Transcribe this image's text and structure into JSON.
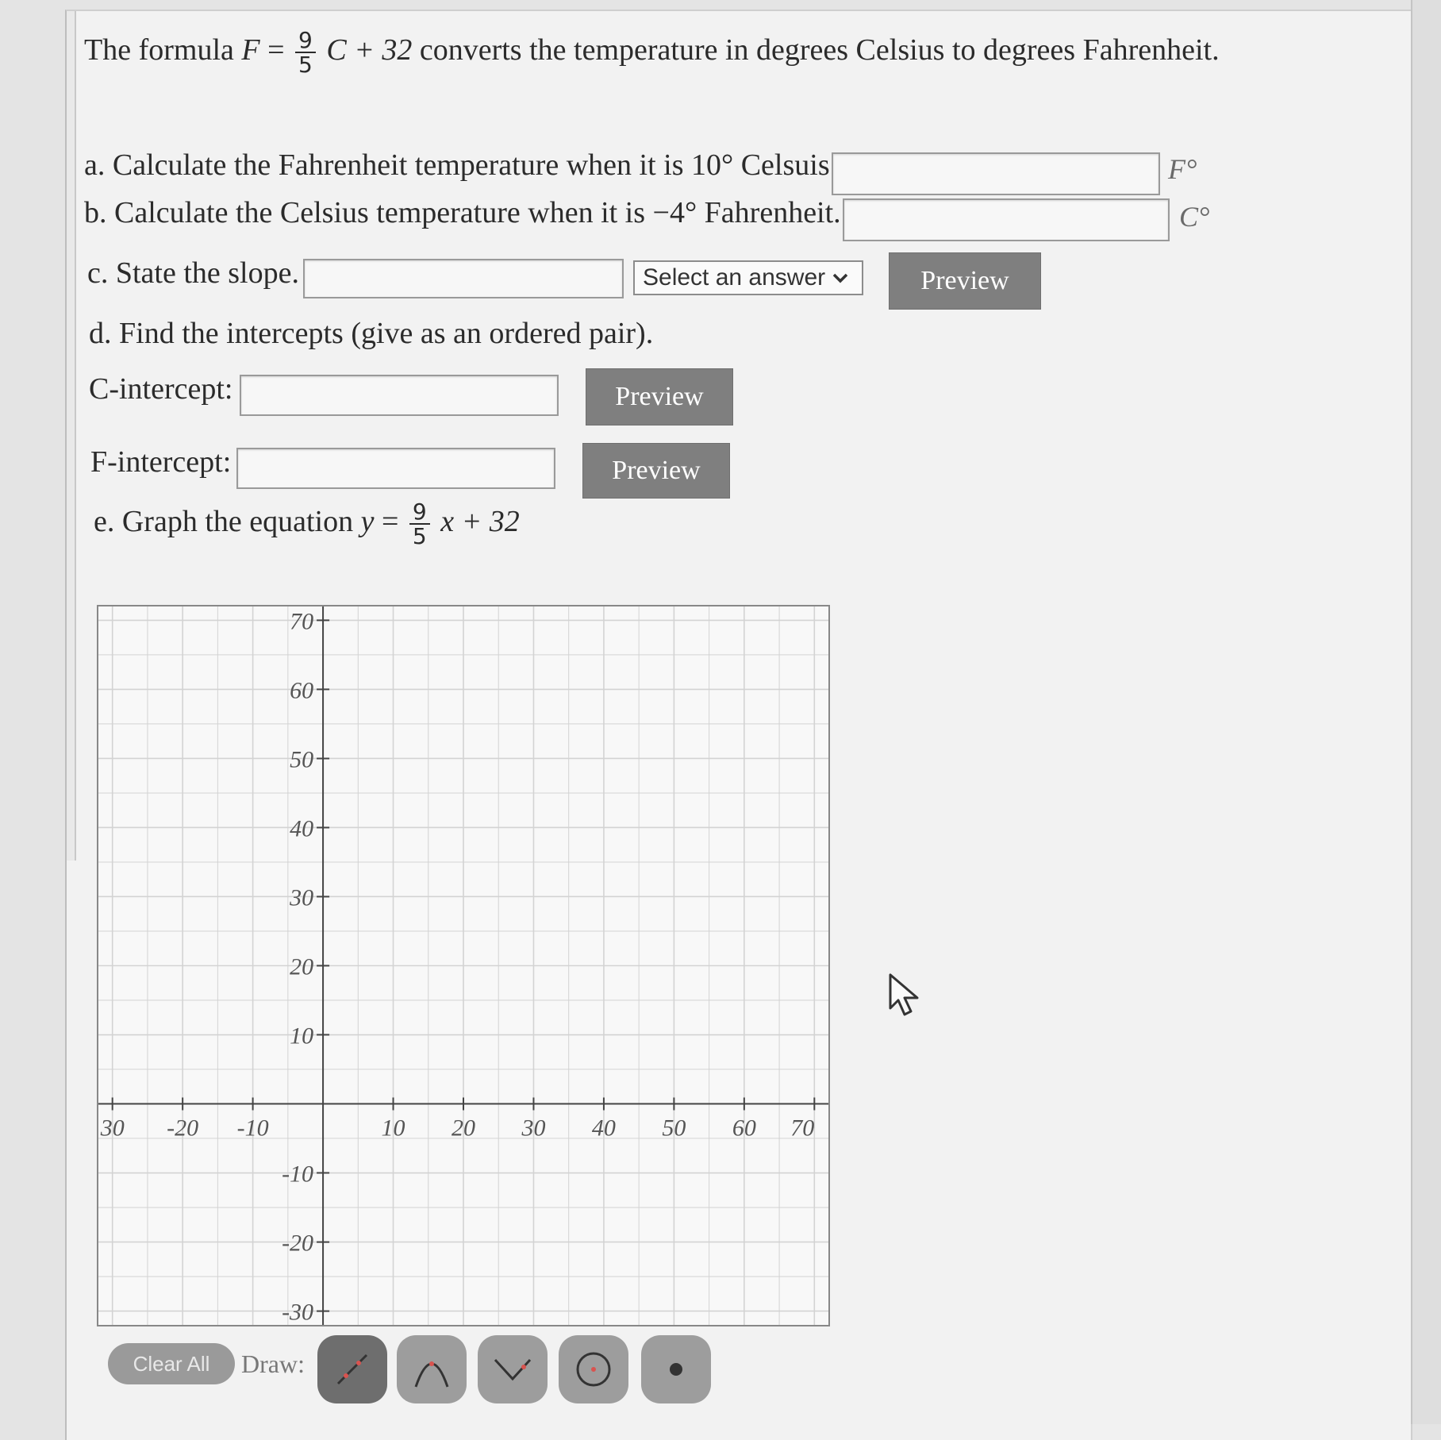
{
  "intro": {
    "pre": "The formula",
    "lhs": "F",
    "eq": "=",
    "num": "9",
    "den": "5",
    "rhs": "C + 32",
    "post": "converts the temperature in degrees Celsius to degrees Fahrenheit."
  },
  "parts": {
    "a": {
      "prefix": "a. Calculate the Fahrenheit temperature when it is",
      "value": "10°",
      "suffix": "Celsuis.",
      "unit": "F°"
    },
    "b": {
      "prefix": "b. Calculate the Celsius temperature when it is",
      "value": "−4°",
      "suffix": "Fahrenheit.",
      "unit": "C°"
    },
    "c": {
      "label": "c. State the slope.",
      "select": "Select an answer",
      "preview": "Preview"
    },
    "d": {
      "label": "d. Find the intercepts (give as an ordered pair).",
      "c_label": "C-intercept:",
      "f_label": "F-intercept:",
      "preview1": "Preview",
      "preview2": "Preview"
    },
    "e": {
      "label": "e. Graph the equation",
      "lhs": "y",
      "eq": "=",
      "num": "9",
      "den": "5",
      "rhs": "x + 32"
    }
  },
  "graph": {
    "x_ticks": [
      "30",
      "-20",
      "-10",
      "10",
      "20",
      "30",
      "40",
      "50",
      "60",
      "70"
    ],
    "y_ticks": [
      "70",
      "60",
      "50",
      "40",
      "30",
      "20",
      "10",
      "-10",
      "-20",
      "-30"
    ]
  },
  "toolbar": {
    "clear_label": "Clear All",
    "draw_label": "Draw:",
    "tools": [
      "line-tool-icon",
      "parabola-tool-icon",
      "absolute-value-tool-icon",
      "circle-tool-icon",
      "point-tool-icon"
    ]
  },
  "colors": {
    "button_gray": "#7f7f7f",
    "accent_red": "#d9534f"
  }
}
